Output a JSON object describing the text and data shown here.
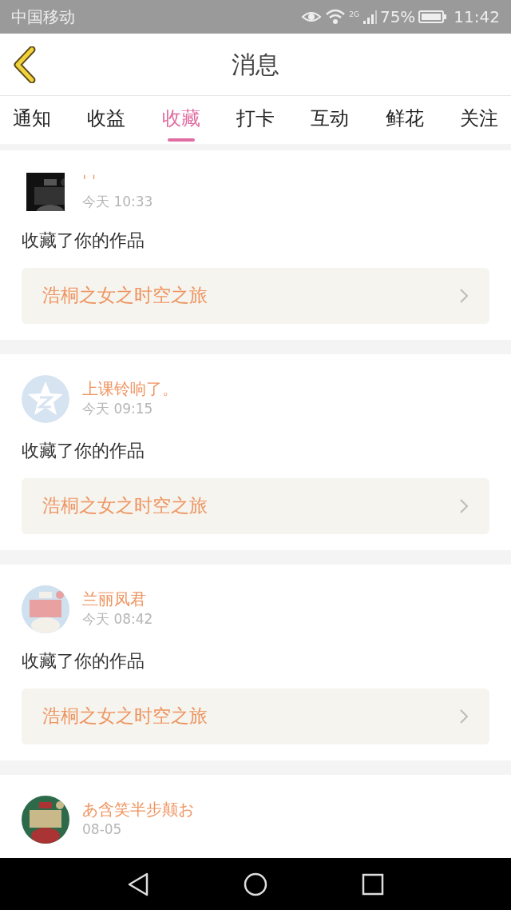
{
  "status_bar": {
    "carrier": "中国移动",
    "network": "2G",
    "battery": "75%",
    "time": "11:42"
  },
  "header": {
    "title": "消息"
  },
  "tabs": [
    {
      "label": "通知",
      "selected": false
    },
    {
      "label": "收益",
      "selected": false
    },
    {
      "label": "收藏",
      "selected": true
    },
    {
      "label": "打卡",
      "selected": false
    },
    {
      "label": "互动",
      "selected": false
    },
    {
      "label": "鲜花",
      "selected": false
    },
    {
      "label": "关注",
      "selected": false
    }
  ],
  "messages": [
    {
      "kind": "picture",
      "user": "ˈ ˈ",
      "time": "今天 10:33",
      "action": "收藏了你的作品",
      "work": "浩桐之女之时空之旅"
    },
    {
      "kind": "default",
      "user": "上课铃响了。",
      "time": "今天 09:15",
      "action": "收藏了你的作品",
      "work": "浩桐之女之时空之旅"
    },
    {
      "kind": "picture",
      "user": "兰丽凤君",
      "time": "今天 08:42",
      "action": "收藏了你的作品",
      "work": "浩桐之女之时空之旅"
    },
    {
      "kind": "picture",
      "user": "あ含笑半步颠お",
      "time": "08-05"
    }
  ]
}
